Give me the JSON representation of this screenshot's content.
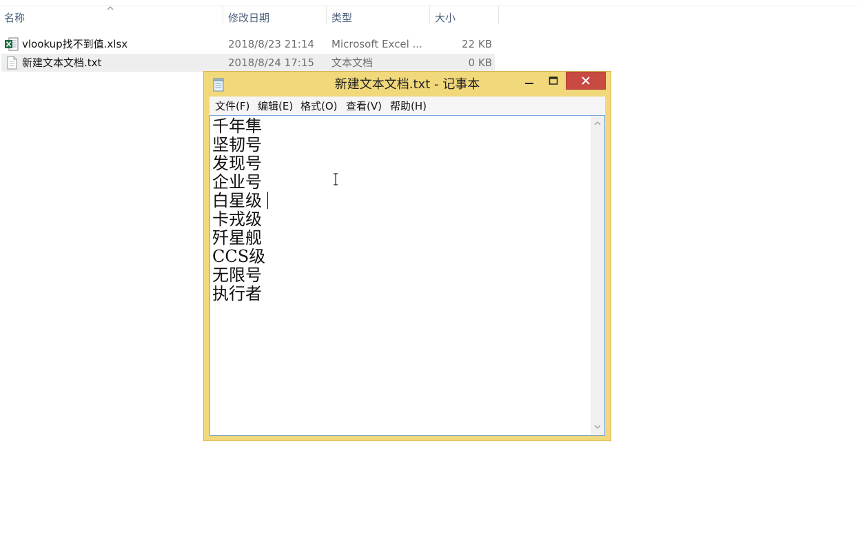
{
  "explorer": {
    "columns": [
      "名称",
      "修改日期",
      "类型",
      "大小"
    ],
    "files": [
      {
        "name": "vlookup找不到值.xlsx",
        "date": "2018/8/23 21:14",
        "type": "Microsoft Excel ...",
        "size": "22 KB",
        "icon": "excel-file-icon"
      },
      {
        "name": "新建文本文档.txt",
        "date": "2018/8/24 17:15",
        "type": "文本文档",
        "size": "0 KB",
        "icon": "text-file-icon"
      }
    ],
    "sort_icon": "sort-ascending-icon"
  },
  "notepad": {
    "title": "新建文本文档.txt - 记事本",
    "icon": "notepad-icon",
    "menu": [
      "文件(F)",
      "编辑(E)",
      "格式(O)",
      "查看(V)",
      "帮助(H)"
    ],
    "lines": [
      "千年隼",
      "坚韧号",
      "发现号",
      "企业号",
      "白星级",
      "卡戎级",
      "歼星舰",
      "CCS级",
      "无限号",
      "执行者"
    ],
    "colors": {
      "frame": "#f1d87a",
      "close_button": "#c94a42",
      "editor_border": "#7aa7d6"
    }
  }
}
